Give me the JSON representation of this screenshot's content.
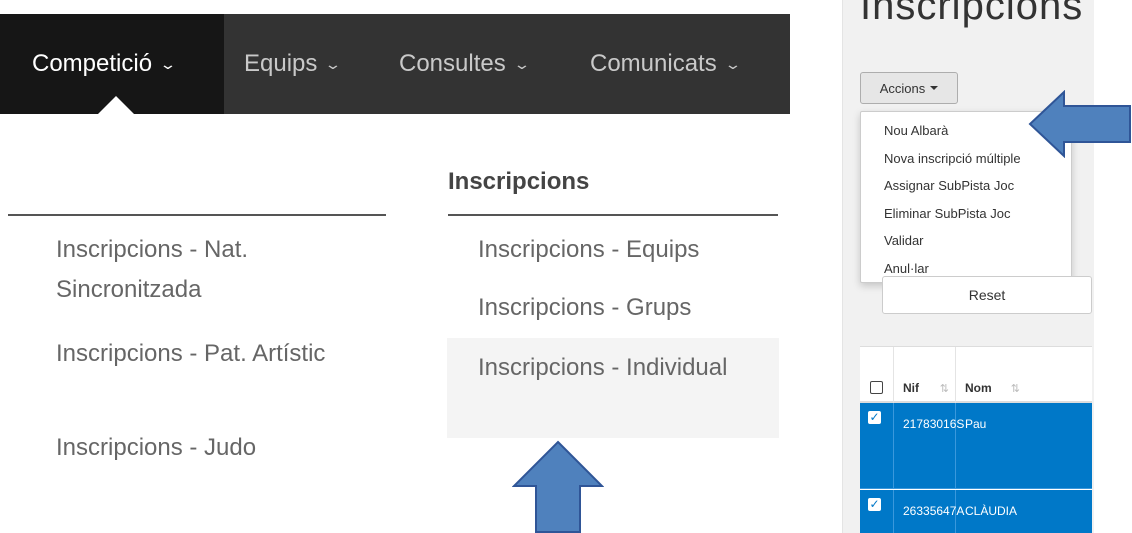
{
  "navbar": {
    "items": [
      {
        "label": "Competició",
        "chevron": "⌄"
      },
      {
        "label": "Equips",
        "chevron": "⌄"
      },
      {
        "label": "Consultes",
        "chevron": "⌄"
      },
      {
        "label": "Comunicats",
        "chevron": "⌄"
      }
    ],
    "active": "Competició",
    "bg_color": "#333333",
    "active_bg_color": "#161616"
  },
  "megamenu": {
    "column1": {
      "items": [
        "Inscripcions - Nat. Sincronitzada",
        "Inscripcions - Pat. Artístic",
        "Inscripcions - Judo"
      ]
    },
    "column2": {
      "heading": "Inscripcions",
      "items": [
        "Inscripcions - Equips",
        "Inscripcions - Grups",
        "Inscripcions - Individual"
      ],
      "highlighted": "Inscripcions - Individual"
    }
  },
  "right_panel": {
    "page_title": "Inscripcions",
    "accions_button": "Accions",
    "accions_menu": [
      "Nou Albarà",
      "Nova inscripció múltiple",
      "Assignar SubPista Joc",
      "Eliminar SubPista Joc",
      "Validar",
      "Anul·lar"
    ],
    "reset_button": "Reset",
    "table": {
      "columns": [
        "",
        "Nif",
        "Nom"
      ],
      "sort_icon": "⇅",
      "rows": [
        {
          "checked": true,
          "nif": "21783016S",
          "nom": "Pau"
        },
        {
          "checked": true,
          "nif": "26335647A",
          "nom": "CLÀUDIA"
        }
      ],
      "selected_row_color": "#0078c8"
    }
  },
  "annotations": {
    "arrow_color": "#4f81bd",
    "arrow_border_color": "#2f5597"
  }
}
